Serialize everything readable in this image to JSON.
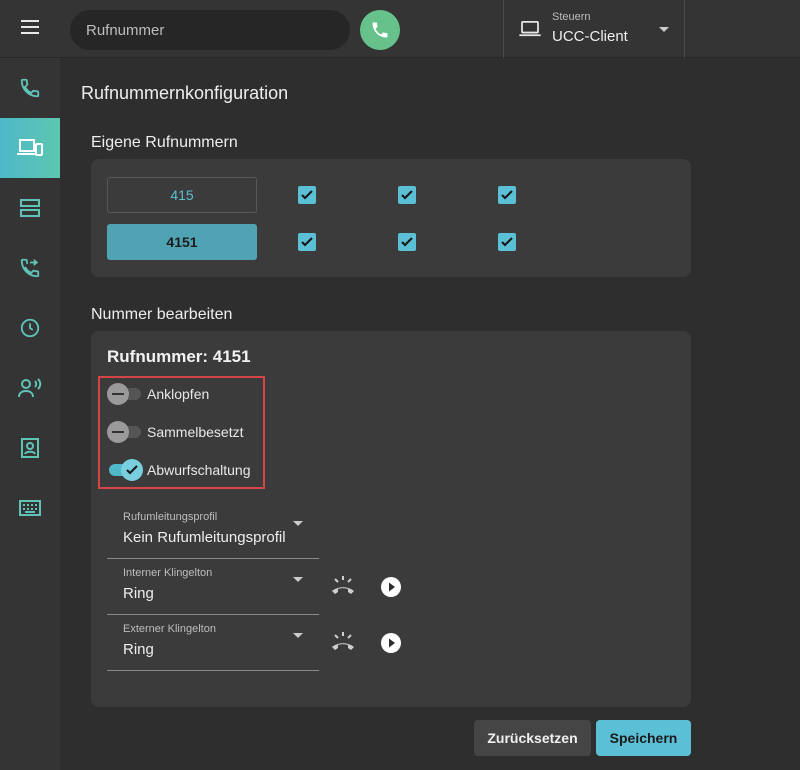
{
  "search": {
    "placeholder": "Rufnummer"
  },
  "control": {
    "label": "Steuern",
    "value": "UCC-Client"
  },
  "sidebar": {
    "items": [
      {
        "icon": "phone-icon",
        "active": false
      },
      {
        "icon": "devices-icon",
        "active": true
      },
      {
        "icon": "server-icon",
        "active": false
      },
      {
        "icon": "call-forward-icon",
        "active": false
      },
      {
        "icon": "clock-icon",
        "active": false
      },
      {
        "icon": "voice-person-icon",
        "active": false
      },
      {
        "icon": "contact-book-icon",
        "active": false
      },
      {
        "icon": "keyboard-icon",
        "active": false
      }
    ]
  },
  "page": {
    "title": "Rufnummernkonfiguration"
  },
  "own_numbers": {
    "title": "Eigene Rufnummern",
    "rows": [
      {
        "number": "415",
        "selected": false,
        "checks": [
          true,
          true,
          true
        ]
      },
      {
        "number": "4151",
        "selected": true,
        "checks": [
          true,
          true,
          true
        ]
      }
    ]
  },
  "edit": {
    "section_title": "Nummer bearbeiten",
    "heading": "Rufnummer: 4151",
    "toggles": [
      {
        "label": "Anklopfen",
        "on": false
      },
      {
        "label": "Sammelbesetzt",
        "on": false
      },
      {
        "label": "Abwurfschaltung",
        "on": true
      }
    ],
    "selects": [
      {
        "label": "Rufumleitungsprofil",
        "value": "Kein Rufumleitungsprofil"
      },
      {
        "label": "Interner Klingelton",
        "value": "Ring"
      },
      {
        "label": "Externer Klingelton",
        "value": "Ring"
      }
    ]
  },
  "actions": {
    "reset": "Zurücksetzen",
    "save": "Speichern"
  },
  "colors": {
    "accent": "#5bc0d6",
    "call_green": "#67c18a",
    "highlight": "#d64545"
  }
}
